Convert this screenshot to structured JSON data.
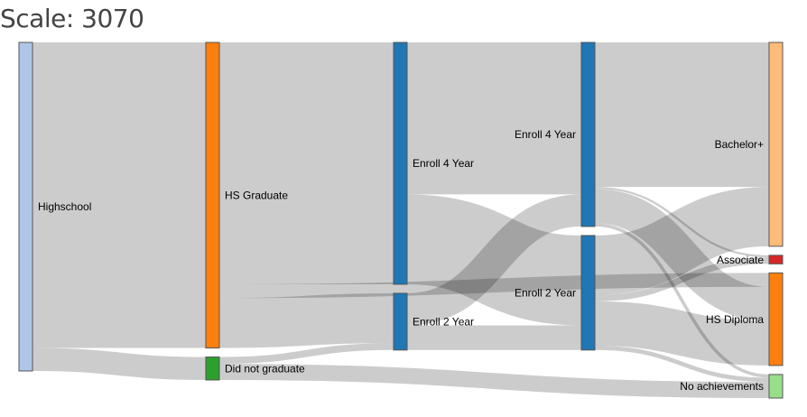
{
  "header": {
    "title": "Scale: 3070"
  },
  "chart_data": {
    "type": "sankey",
    "title": "Scale: 3070",
    "stages": [
      [
        "Highschool"
      ],
      [
        "HS Graduate",
        "Did not graduate"
      ],
      [
        "Enroll 4 Year",
        "Enroll 2 Year"
      ],
      [
        "Enroll 4 Year",
        "Enroll 2 Year"
      ],
      [
        "Bachelor+",
        "Associate",
        "HS Diploma",
        "No achievements"
      ]
    ],
    "nodes": [
      {
        "id": "hs",
        "name": "Highschool",
        "stage": 0,
        "value": 3070,
        "color": "#aec7e8"
      },
      {
        "id": "grad",
        "name": "HS Graduate",
        "stage": 1,
        "value": 2855,
        "color": "#ff7f0e"
      },
      {
        "id": "nograd",
        "name": "Did not graduate",
        "stage": 1,
        "value": 215,
        "color": "#2ca02c"
      },
      {
        "id": "e4a",
        "name": "Enroll 4 Year",
        "stage": 2,
        "value": 2260,
        "color": "#1f77b4"
      },
      {
        "id": "e2a",
        "name": "Enroll 2 Year",
        "stage": 2,
        "value": 530,
        "color": "#1f77b4"
      },
      {
        "id": "e4b",
        "name": "Enroll 4 Year",
        "stage": 3,
        "value": 1720,
        "color": "#1f77b4"
      },
      {
        "id": "e2b",
        "name": "Enroll 2 Year",
        "stage": 3,
        "value": 1070,
        "color": "#1f77b4"
      },
      {
        "id": "bach",
        "name": "Bachelor+",
        "stage": 4,
        "value": 1905,
        "color": "#ffbb78"
      },
      {
        "id": "assoc",
        "name": "Associate",
        "stage": 4,
        "value": 80,
        "color": "#d62728"
      },
      {
        "id": "dipl",
        "name": "HS Diploma",
        "stage": 4,
        "value": 865,
        "color": "#ff7f0e"
      },
      {
        "id": "none",
        "name": "No achievements",
        "stage": 4,
        "value": 220,
        "color": "#98df8a"
      }
    ],
    "links": [
      {
        "source": "hs",
        "target": "grad",
        "value": 2855
      },
      {
        "source": "hs",
        "target": "nograd",
        "value": 215
      },
      {
        "source": "grad",
        "target": "e4a",
        "value": 2260
      },
      {
        "source": "grad",
        "target": "e2a",
        "value": 465
      },
      {
        "source": "grad",
        "target": "dipl",
        "value": 130
      },
      {
        "source": "nograd",
        "target": "e4a",
        "value": 0
      },
      {
        "source": "nograd",
        "target": "e2a",
        "value": 65
      },
      {
        "source": "nograd",
        "target": "none",
        "value": 150
      },
      {
        "source": "e4a",
        "target": "e4b",
        "value": 1420
      },
      {
        "source": "e4a",
        "target": "e2b",
        "value": 840
      },
      {
        "source": "e2a",
        "target": "e4b",
        "value": 300
      },
      {
        "source": "e2a",
        "target": "e2b",
        "value": 230
      },
      {
        "source": "e4b",
        "target": "bach",
        "value": 1350
      },
      {
        "source": "e4b",
        "target": "assoc",
        "value": 20
      },
      {
        "source": "e4b",
        "target": "dipl",
        "value": 320
      },
      {
        "source": "e4b",
        "target": "none",
        "value": 30
      },
      {
        "source": "e2b",
        "target": "bach",
        "value": 555
      },
      {
        "source": "e2b",
        "target": "assoc",
        "value": 60
      },
      {
        "source": "e2b",
        "target": "dipl",
        "value": 415
      },
      {
        "source": "e2b",
        "target": "none",
        "value": 40
      }
    ],
    "link_color": "#000000",
    "link_opacity": 0.2
  }
}
